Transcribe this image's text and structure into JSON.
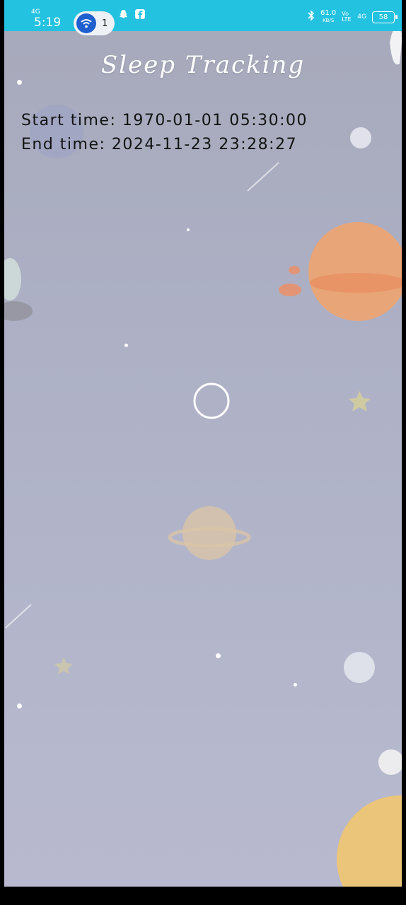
{
  "status_bar": {
    "network": "4G",
    "time": "5:19",
    "notification_count": "1",
    "speed_value": "61.0",
    "speed_unit": "KB/S",
    "volte": "Vo LTE",
    "signal": "4G",
    "battery": "58"
  },
  "page": {
    "title": "Sleep Tracking"
  },
  "sleep": {
    "start_label": "Start time:",
    "start_value": "1970-01-01 05:30:00",
    "end_label": "End time:",
    "end_value": "2024-11-23 23:28:27"
  },
  "icons": [
    "wifi-hotspot-icon",
    "snapchat-icon",
    "facebook-icon",
    "bluetooth-icon",
    "battery-icon"
  ],
  "colors": {
    "status_bar": "#23c2e0",
    "background": "#aeb1c6",
    "title": "#ffffff",
    "text": "#121212"
  }
}
